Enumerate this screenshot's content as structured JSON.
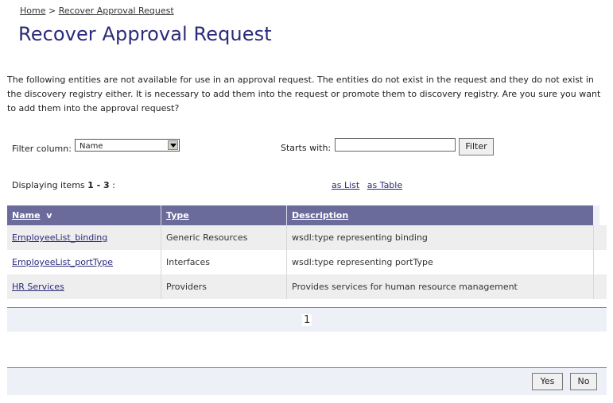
{
  "breadcrumb": {
    "home": "Home",
    "separator": ">",
    "current": "Recover Approval Request"
  },
  "page_title": "Recover Approval Request",
  "intro_text": "The following entities are not available for use in an approval request. The entities do not exist in the request and they do not exist in the discovery registry either. It is necessary to add them into the request or promote them to discovery registry. Are you sure you want to add them into the approval request?",
  "filter": {
    "column_label": "Filter column:",
    "column_value": "Name",
    "starts_with_label": "Starts with:",
    "starts_with_value": "",
    "button": "Filter"
  },
  "display": {
    "prefix": "Displaying items ",
    "range": "1 - 3",
    "suffix": " :"
  },
  "view_links": {
    "as_list": "as List",
    "as_table": "as Table"
  },
  "table": {
    "headers": {
      "name": "Name",
      "sort_indicator": "v",
      "type": "Type",
      "description": "Description"
    },
    "rows": [
      {
        "name": "EmployeeList_binding",
        "type": "Generic Resources",
        "description": "wsdl:type representing binding"
      },
      {
        "name": "EmployeeList_portType",
        "type": "Interfaces",
        "description": "wsdl:type representing portType"
      },
      {
        "name": "HR Services",
        "type": "Providers",
        "description": "Provides services for human resource management"
      }
    ]
  },
  "pager": {
    "current_page": "1"
  },
  "actions": {
    "yes": "Yes",
    "no": "No"
  }
}
